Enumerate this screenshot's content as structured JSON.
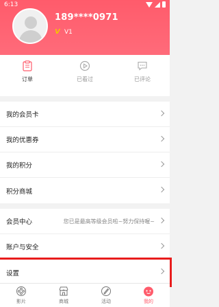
{
  "status_bar": {
    "time": "6:13"
  },
  "profile": {
    "phone": "189****0971",
    "level": "V1"
  },
  "quick_actions": [
    {
      "label": "订单",
      "icon": "clipboard-icon"
    },
    {
      "label": "已看过",
      "icon": "play-circle-icon"
    },
    {
      "label": "已评论",
      "icon": "comment-icon"
    }
  ],
  "menu_group1": [
    {
      "label": "我的会员卡"
    },
    {
      "label": "我的优惠券"
    },
    {
      "label": "我的积分"
    },
    {
      "label": "积分商城"
    }
  ],
  "menu_group2": [
    {
      "label": "会员中心",
      "sub": "您已是最高等级会员啦~努力保持喔~"
    },
    {
      "label": "账户与安全"
    },
    {
      "label": "设置"
    }
  ],
  "tabs": [
    {
      "label": "影片",
      "icon": "film-reel-icon"
    },
    {
      "label": "商城",
      "icon": "store-icon"
    },
    {
      "label": "活动",
      "icon": "activity-icon"
    },
    {
      "label": "我的",
      "icon": "profile-icon",
      "active": true
    }
  ],
  "colors": {
    "accent": "#ff5b6b",
    "highlight": "#e81c1c"
  }
}
